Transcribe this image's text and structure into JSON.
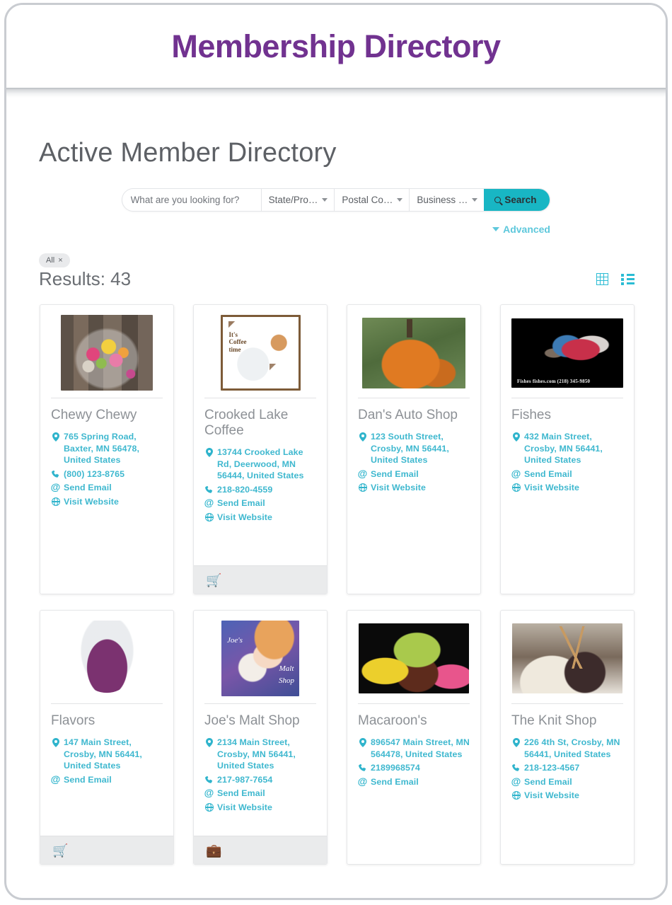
{
  "banner": {
    "title": "Membership Directory"
  },
  "page": {
    "heading": "Active Member Directory"
  },
  "search": {
    "placeholder": "What are you looking for?",
    "value": "",
    "state_select": "State/Pro…",
    "postal_select": "Postal Co…",
    "business_select": "Business …",
    "search_label": "Search",
    "advanced_label": "Advanced"
  },
  "filters": {
    "chip_label": "All",
    "chip_close": "×"
  },
  "results": {
    "label": "Results: 43"
  },
  "view": {
    "grid_title": "Grid view",
    "list_title": "List view"
  },
  "labels": {
    "send_email": "Send Email",
    "visit_website": "Visit Website"
  },
  "colors": {
    "accent_teal": "#3fb8cf",
    "button_teal": "#18b6c4",
    "title_purple": "#713290",
    "card_title_grey": "#8d9196",
    "footer_grey": "#eaebec"
  },
  "cards": [
    {
      "name": "Chewy Chewy",
      "address": "765 Spring Road, Baxter, MN 56478, United States",
      "phone": "(800) 123-8765",
      "email": "Send Email",
      "website": "Visit Website",
      "footer_icon": "",
      "thumb_alt": "jar of colorful candy"
    },
    {
      "name": "Crooked Lake Coffee",
      "address": "13744 Crooked Lake Rd, Deerwood, MN 56444, United States",
      "phone": "218-820-4559",
      "email": "Send Email",
      "website": "Visit Website",
      "footer_icon": "shopping-cart-icon",
      "thumb_alt": "It's Coffee time dog poster"
    },
    {
      "name": "Dan's Auto Shop",
      "address": "123 South Street, Crosby, MN 56441, United States",
      "phone": "",
      "email": "Send Email",
      "website": "Visit Website",
      "footer_icon": "",
      "thumb_alt": "pumpkin in grass"
    },
    {
      "name": "Fishes",
      "address": "432 Main Street, Crosby, MN 56441, United States",
      "phone": "",
      "email": "Send Email",
      "website": "Visit Website",
      "footer_icon": "",
      "thumb_alt": "betta fish on black background",
      "thumb_caption": "Fishes  fishes.com  (218) 345-9850"
    },
    {
      "name": "Flavors",
      "address": "147 Main Street, Crosby, MN 56441, United States",
      "phone": "",
      "email": "Send Email",
      "website": "",
      "footer_icon": "shopping-cart-icon",
      "thumb_alt": "wine glass with red wine"
    },
    {
      "name": "Joe's Malt Shop",
      "address": "2134 Main Street, Crosby, MN 56441, United States",
      "phone": "217-987-7654",
      "email": "Send Email",
      "website": "Visit Website",
      "footer_icon": "briefcase-icon",
      "thumb_alt": "retro Joe's Malt Shop poster"
    },
    {
      "name": "Macaroon's",
      "address": "896547 Main Street, MN 564478, United States",
      "phone": "2189968574",
      "email": "Send Email",
      "website": "",
      "footer_icon": "",
      "thumb_alt": "assorted macarons"
    },
    {
      "name": "The Knit Shop",
      "address": "226 4th St, Crosby, MN 56441, United States",
      "phone": "218-123-4567",
      "email": "Send Email",
      "website": "Visit Website",
      "footer_icon": "",
      "thumb_alt": "yarn ball with knitting needles"
    }
  ]
}
